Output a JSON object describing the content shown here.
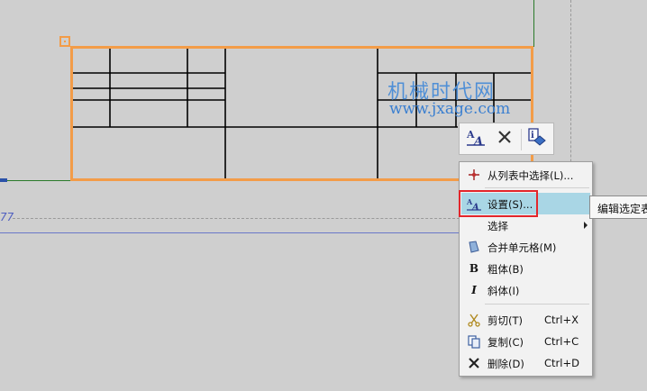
{
  "canvas": {
    "background": "#cfcfcf",
    "accent_orange": "#f39c48",
    "axis_green": "#2a7a2a"
  },
  "watermark": {
    "title": "机械时代网",
    "url": "www.jxage.com"
  },
  "dim_text": "77",
  "mini_toolbar": {
    "items": [
      {
        "icon": "text-style-icon",
        "label": "A"
      },
      {
        "icon": "delete-x-icon"
      },
      {
        "icon": "properties-icon"
      }
    ]
  },
  "context_menu": {
    "items": [
      {
        "icon": "pick-list-icon",
        "label": "从列表中选择(L)..."
      },
      {
        "icon": "settings-a-icon",
        "label": "设置(S)...",
        "highlighted": true
      },
      {
        "icon": "",
        "label": "选择",
        "submenu": true
      },
      {
        "icon": "merge-cells-icon",
        "label": "合并单元格(M)"
      },
      {
        "icon": "bold-icon",
        "label": "粗体(B)",
        "glyph": "B"
      },
      {
        "icon": "italic-icon",
        "label": "斜体(I)",
        "glyph": "I"
      },
      {
        "icon": "scissors-icon",
        "label": "剪切(T)",
        "shortcut": "Ctrl+X"
      },
      {
        "icon": "copy-icon",
        "label": "复制(C)",
        "shortcut": "Ctrl+C"
      },
      {
        "icon": "delete-x-icon",
        "label": "删除(D)",
        "shortcut": "Ctrl+D"
      }
    ]
  },
  "tooltip": {
    "text": "编辑选定表"
  }
}
